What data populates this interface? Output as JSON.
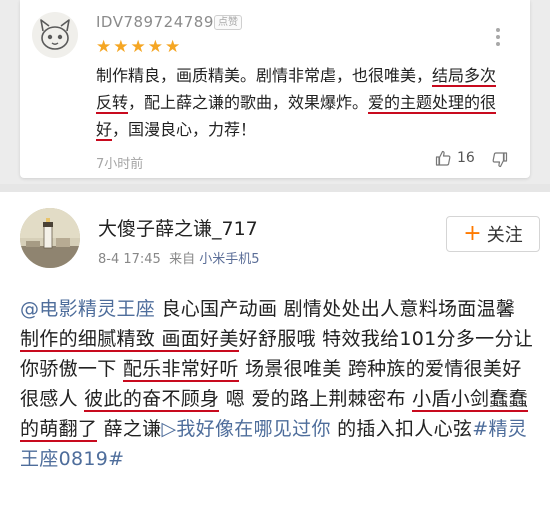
{
  "review": {
    "username": "IDV789724789",
    "badge": "点赞",
    "rating": 5,
    "text": [
      {
        "t": "制作精良，画质精美。剧情非常虐，也很唯美，",
        "u": false
      },
      {
        "t": "结局多次反转",
        "u": true
      },
      {
        "t": "，配上薛之谦的歌曲，效果爆炸。",
        "u": false
      },
      {
        "t": "爱的主题处理的很好",
        "u": true
      },
      {
        "t": "，国漫良心，力荐！",
        "u": false
      }
    ],
    "time": "7小时前",
    "likes": "16",
    "icons": {
      "like": "thumbs-up-icon",
      "dislike": "thumbs-down-icon",
      "more": "more-vertical-icon"
    }
  },
  "post": {
    "username": "大傻子薛之谦_717",
    "date": "8-4 17:45",
    "from_label": "来自",
    "device": "小米手机5",
    "follow_label": "关注",
    "body": [
      {
        "t": "@电影精灵王座",
        "k": "link"
      },
      {
        "t": " 良心国产动画 剧情处处出人意料场面温馨 ",
        "k": ""
      },
      {
        "t": "制作的细腻精致 画面好美",
        "k": "u"
      },
      {
        "t": "好舒服哦 特效我给101分多一分让你骄傲一下 ",
        "k": ""
      },
      {
        "t": "配乐非常好听",
        "k": "u"
      },
      {
        "t": " 场景很唯美 跨种族的爱情很美好很感人 ",
        "k": ""
      },
      {
        "t": "彼此的奋不顾身",
        "k": "u"
      },
      {
        "t": " 嗯 爱的路上荆棘密布 ",
        "k": ""
      },
      {
        "t": "小盾小剑蠢蠢的萌翻了",
        "k": "u"
      },
      {
        "t": " 薛之谦",
        "k": ""
      },
      {
        "t": "▷我好像在哪见过你",
        "k": "link"
      },
      {
        "t": " 的插入扣人心弦",
        "k": ""
      },
      {
        "t": "#精灵王座0819#",
        "k": "link"
      }
    ]
  },
  "colors": {
    "accent_red": "#c80a1e",
    "star": "#f5a623",
    "link": "#4e6d9b",
    "follow_plus": "#ff7a00"
  }
}
